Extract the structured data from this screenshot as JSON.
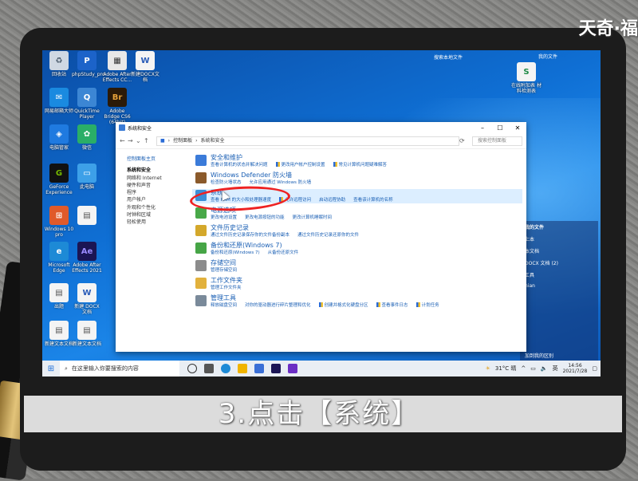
{
  "watermark": "天奇·福",
  "caption": "3.点击【系统】",
  "desktop_icons": {
    "i1": "回收站",
    "i2": "phpStudy_pro",
    "i3": "Adobe After Effects CC...",
    "i4": "新建DOCX文档",
    "i5": "网易邮箱大师",
    "i6": "QuickTime Player",
    "i7": "Adobe Bridge CS6 (64bit)",
    "i8": "电脑管家",
    "i9": "微信",
    "i10": "GeForce Experience",
    "i11": "此电脑",
    "i12": "Windows 10 pro",
    "i13": "Adobe After Effects 2021",
    "i14": "Microsoft Edge",
    "i15": "出题",
    "i16": "新建 DOCX 文档",
    "i17": "新建文本文档",
    "i18": "新建文本文档"
  },
  "right_desktop": {
    "search_label": "搜索本地文件",
    "label1": "我的文件",
    "file_label": "在线附加表 材料检测表",
    "panel_title": "我的文件",
    "rows": [
      "上本",
      "本文档",
      "DOCX 文档 (2)",
      "工具",
      "nian"
    ],
    "bottom_note": "加到我的区别"
  },
  "window": {
    "title": "系统和安全",
    "path": [
      "控制面板",
      "系统和安全"
    ],
    "search_placeholder": "搜索控制面板",
    "left_nav": [
      "控制面板主页",
      "系统和安全",
      "网络和 Internet",
      "硬件和声音",
      "程序",
      "用户帐户",
      "外观和个性化",
      "时钟和区域",
      "轻松使用"
    ],
    "categories": [
      {
        "title": "安全和维护",
        "links": [
          "查看计算机的状态并解决问题",
          "更改用户帐户控制设置",
          "常见计算机问题疑难解答"
        ],
        "color": "#3b7bd9"
      },
      {
        "title": "Windows Defender 防火墙",
        "links": [
          "检查防火墙状态",
          "允许应用通过 Windows 防火墙"
        ],
        "color": "#8b5a2b"
      },
      {
        "title": "系统",
        "links": [
          "查看 RAM 的大小和处理器速度",
          "允许远程访问",
          "启动远程协助",
          "查看该计算机的名称"
        ],
        "color": "#3a8fd8"
      },
      {
        "title": "电源选项",
        "links": [
          "更改电池设置",
          "更改电源按钮的功能",
          "更改计算机睡眠时间"
        ],
        "color": "#48a848"
      },
      {
        "title": "文件历史记录",
        "links": [
          "通过文件历史记录保存你的文件备份副本",
          "通过文件历史记录还原你的文件"
        ],
        "color": "#d4a82b"
      },
      {
        "title": "备份和还原(Windows 7)",
        "links": [
          "备份和还原(Windows 7)",
          "从备份还原文件"
        ],
        "color": "#46a546"
      },
      {
        "title": "存储空间",
        "links": [
          "管理存储空间"
        ],
        "color": "#8c8c8c"
      },
      {
        "title": "工作文件夹",
        "links": [
          "管理工作文件夹"
        ],
        "color": "#e2b13c"
      },
      {
        "title": "管理工具",
        "links": [
          "释放磁盘空间",
          "对你的驱动器进行碎片整理和优化",
          "创建并格式化硬盘分区",
          "查看事件日志",
          "计划任务"
        ],
        "color": "#7a8a9a"
      }
    ]
  },
  "taskbar": {
    "search_placeholder": "在这里输入你要搜索的内容",
    "weather": "31°C 晴",
    "ime": "英",
    "time": "14:56",
    "date": "2021/7/28"
  }
}
